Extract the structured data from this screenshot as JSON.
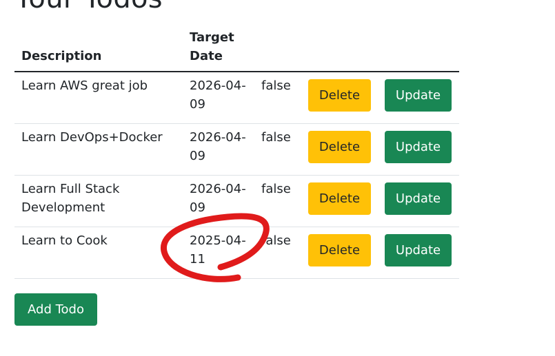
{
  "page": {
    "title": "Your Todos"
  },
  "table": {
    "headers": {
      "description": "Description",
      "target_date": "Target Date"
    },
    "rows": [
      {
        "description": "Learn AWS great job",
        "target_date": "2026-04-09",
        "done": "false"
      },
      {
        "description": "Learn DevOps+Docker",
        "target_date": "2026-04-09",
        "done": "false"
      },
      {
        "description": "Learn Full Stack Development",
        "target_date": "2026-04-09",
        "done": "false"
      },
      {
        "description": "Learn to Cook",
        "target_date": "2025-04-11",
        "done": "false"
      }
    ],
    "delete_label": "Delete",
    "update_label": "Update"
  },
  "actions": {
    "add_todo_label": "Add Todo"
  },
  "colors": {
    "warning": "#ffc107",
    "success": "#198754",
    "annotation": "#e01b1b"
  }
}
